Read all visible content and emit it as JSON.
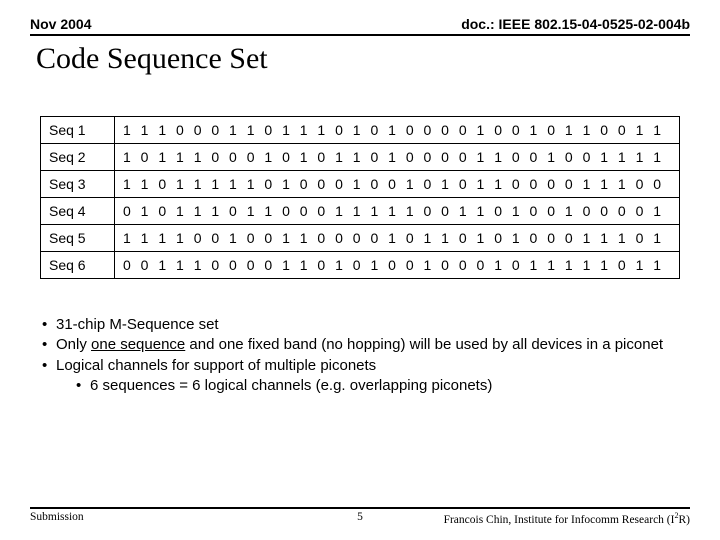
{
  "header": {
    "date": "Nov 2004",
    "docref": "doc.: IEEE 802.15-04-0525-02-004b"
  },
  "title": "Code Sequence Set",
  "sequences": [
    {
      "label": "Seq 1",
      "bits": "1 1 1 0 0 0 1 1 0 1 1 1 0 1 0 1 0 0 0 0 1 0 0 1 0 1 1 0 0 1 1"
    },
    {
      "label": "Seq 2",
      "bits": "1 0 1 1 1 0 0 0 1 0 1 0 1 1 0 1 0 0 0 0 1 1 0 0 1 0 0 1 1 1 1"
    },
    {
      "label": "Seq 3",
      "bits": "1 1 0 1 1 1 1 1 0 1 0 0 0 1 0 0 1 0 1 0 1 1 0 0 0 0 1 1 1 0 0"
    },
    {
      "label": "Seq 4",
      "bits": "0 1 0 1 1 1 0 1 1 0 0 0 1 1 1 1 1 0 0 1 1 0 1 0 0 1 0 0 0 0 1"
    },
    {
      "label": "Seq 5",
      "bits": "1 1 1 1 0 0 1 0 0 1 1 0 0 0 0 1 0 1 1 0 1 0 1 0 0 0 1 1 1 0 1"
    },
    {
      "label": "Seq 6",
      "bits": "0 0 1 1 1 0 0 0 0 1 1 0 1 0 1 0 0 1 0 0 0 1 0 1 1 1 1 1 0 1 1"
    }
  ],
  "bullets": {
    "b1": "31-chip M-Sequence set",
    "b2_pre": "Only ",
    "b2_u": "one sequence",
    "b2_post": " and one fixed band (no hopping) will be used by all devices in a piconet",
    "b3": "Logical channels for support of multiple piconets",
    "b3a": "6 sequences = 6 logical channels (e.g. overlapping piconets)"
  },
  "footer": {
    "left": "Submission",
    "page": "5",
    "right_pre": "Francois Chin, Institute for Infocomm Research (I",
    "right_sup": "2",
    "right_post": "R)"
  }
}
